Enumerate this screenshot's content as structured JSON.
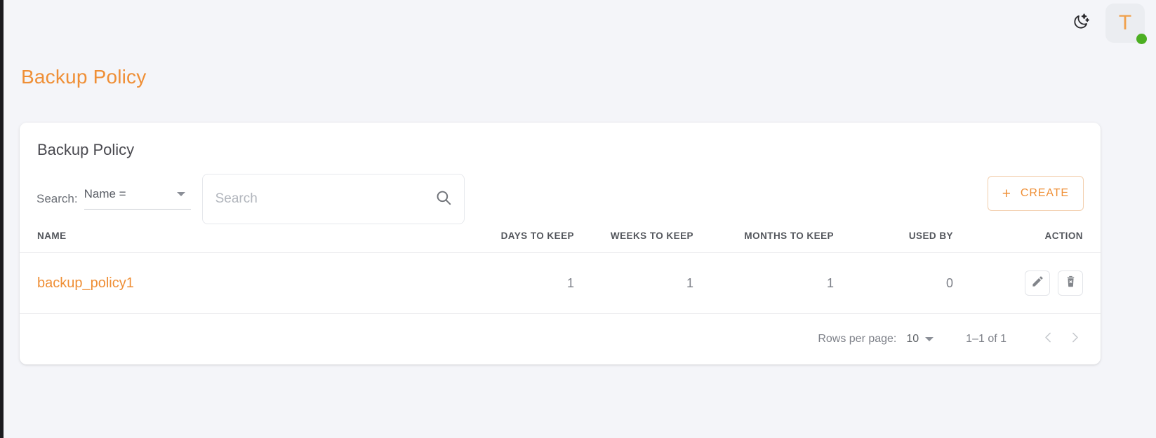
{
  "topbar": {
    "theme_toggle_icon": "moon-stars-icon",
    "avatar_letter": "T",
    "status": "online"
  },
  "page": {
    "title": "Backup Policy"
  },
  "card": {
    "title": "Backup Policy"
  },
  "toolbar": {
    "search_label": "Search:",
    "filter_field_value": "Name =",
    "search_placeholder": "Search",
    "search_value": "",
    "search_icon": "search-icon",
    "create_label": "CREATE",
    "create_plus": "+"
  },
  "table": {
    "columns": [
      "NAME",
      "DAYS TO KEEP",
      "WEEKS TO KEEP",
      "MONTHS TO KEEP",
      "USED BY",
      "ACTION"
    ],
    "rows": [
      {
        "name": "backup_policy1",
        "days_to_keep": "1",
        "weeks_to_keep": "1",
        "months_to_keep": "1",
        "used_by": "0",
        "actions": [
          "edit-icon",
          "delete-icon"
        ]
      }
    ]
  },
  "footer": {
    "rows_per_page_label": "Rows per page:",
    "rows_per_page_value": "10",
    "range_label": "1–1 of 1",
    "prev_icon": "chevron-left-icon",
    "next_icon": "chevron-right-icon"
  },
  "colors": {
    "accent": "#ef8f36",
    "page_bg": "#f4f5f9",
    "card_bg": "#ffffff",
    "status_green": "#4caf22",
    "text_muted": "#7d8088"
  }
}
